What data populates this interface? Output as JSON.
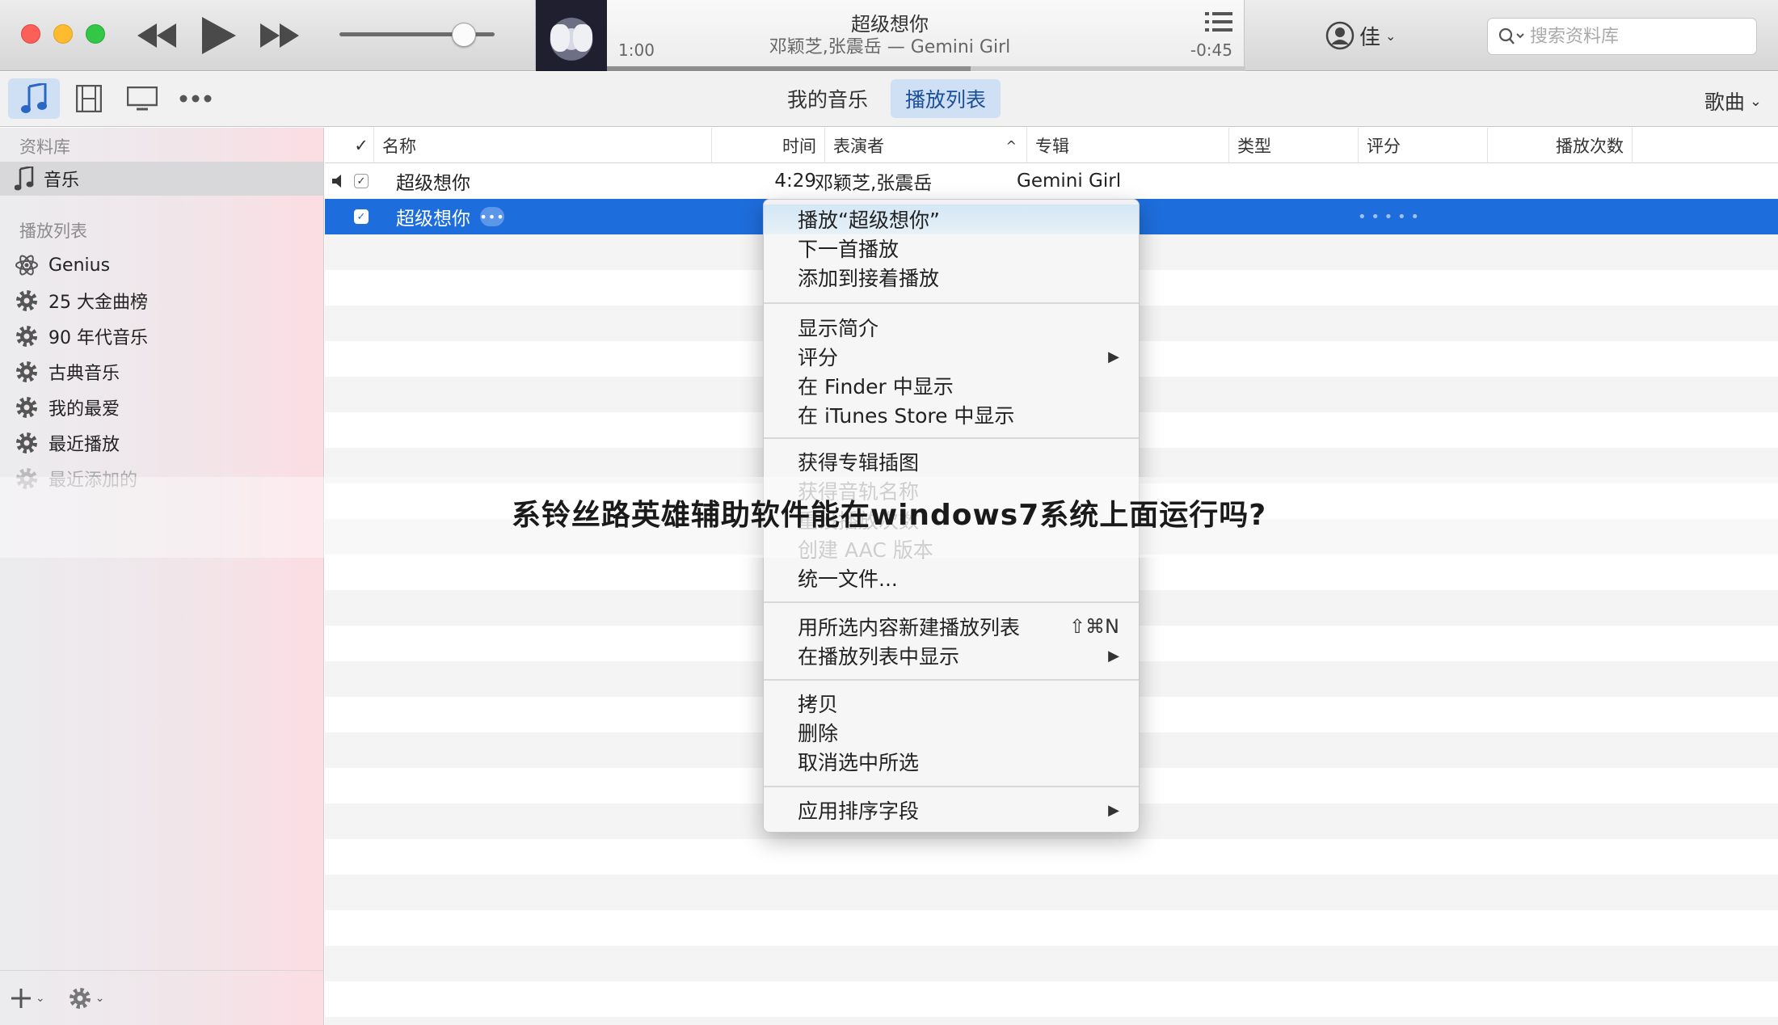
{
  "player": {
    "song_title": "超级想你",
    "song_subtitle": "邓颖芝,张震岳 — Gemini Girl",
    "elapsed": "1:00",
    "remaining": "-0:45",
    "progress": 0.57,
    "volume": 0.8
  },
  "account": {
    "name": "佳"
  },
  "search": {
    "placeholder": "搜索资料库"
  },
  "toolbar": {
    "tab_my_music": "我的音乐",
    "tab_playlists": "播放列表",
    "view_select": "歌曲"
  },
  "sidebar": {
    "library_header": "资料库",
    "library_items": [
      {
        "label": "音乐"
      }
    ],
    "playlists_header": "播放列表",
    "playlists": [
      {
        "label": "Genius"
      },
      {
        "label": "25 大金曲榜"
      },
      {
        "label": "90 年代音乐"
      },
      {
        "label": "古典音乐"
      },
      {
        "label": "我的最爱"
      },
      {
        "label": "最近播放"
      },
      {
        "label": "最近添加的"
      }
    ]
  },
  "list": {
    "columns": {
      "check": "✓",
      "name": "名称",
      "time": "时间",
      "artist": "表演者",
      "album": "专辑",
      "genre": "类型",
      "rating": "评分",
      "plays": "播放次数"
    },
    "rows": [
      {
        "name": "超级想你",
        "time": "4:29",
        "artist": "邓颖芝,张震岳",
        "album": "Gemini Girl"
      },
      {
        "name": "超级想你",
        "more": "•••",
        "rating_dots": "• • • • •"
      }
    ]
  },
  "context_menu": {
    "group1": [
      "播放“超级想你”",
      "下一首播放",
      "添加到接着播放"
    ],
    "group2": [
      "显示简介",
      "评分",
      "在 Finder 中显示",
      "在 iTunes Store 中显示"
    ],
    "group3": [
      "获得专辑插图",
      "获得音轨名称",
      "重设播放次数",
      "创建 AAC 版本",
      "统一文件..."
    ],
    "group4": [
      "用所选内容新建播放列表",
      "在播放列表中显示"
    ],
    "new_playlist_shortcut": "⇧⌘N",
    "group5": [
      "拷贝",
      "删除",
      "取消选中所选"
    ],
    "group6": [
      "应用排序字段"
    ]
  },
  "overlay": {
    "title": "系铃丝路英雄辅助软件能在windows7系统上面运行吗?"
  },
  "colors": {
    "selection": "#1e6ddc",
    "accent_tab": "#cfe0f5"
  }
}
